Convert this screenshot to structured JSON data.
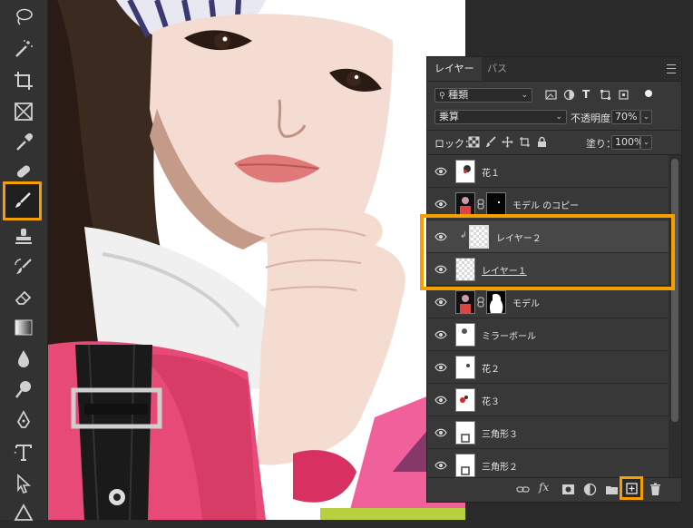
{
  "layers_panel": {
    "tabs": [
      {
        "label": "レイヤー",
        "active": true
      },
      {
        "label": "パス",
        "active": false
      }
    ],
    "filter": {
      "kind_label": "種類"
    },
    "blend_mode": "乗算",
    "opacity": {
      "label": "不透明度：",
      "value": "70%"
    },
    "lock_label": "ロック：",
    "fill": {
      "label": "塗り：",
      "value": "100%"
    },
    "layers": [
      {
        "name": "花１",
        "thumb": "flower",
        "selected": false
      },
      {
        "name": "モデル のコピー",
        "thumb": "model",
        "has_mask": true,
        "selected": false
      },
      {
        "name": "レイヤー２",
        "thumb": "transparent",
        "clipped": true,
        "selected": true
      },
      {
        "name": "レイヤー１",
        "thumb": "transparent",
        "underline": true,
        "selected": false
      },
      {
        "name": "モデル",
        "thumb": "model",
        "has_mask": true,
        "selected": false
      },
      {
        "name": "ミラーボール",
        "thumb": "ball",
        "selected": false
      },
      {
        "name": "花２",
        "thumb": "flower",
        "selected": false
      },
      {
        "name": "花３",
        "thumb": "flower-red",
        "selected": false
      },
      {
        "name": "三角形３",
        "thumb": "triangle",
        "selected": false
      },
      {
        "name": "三角形２",
        "thumb": "triangle",
        "selected": false
      }
    ],
    "footer_icons": [
      "link-icon",
      "fx-icon",
      "mask-icon",
      "adjustment-icon",
      "folder-icon",
      "new-layer-icon",
      "trash-icon"
    ]
  },
  "toolbar": {
    "tools": [
      "lasso-tool",
      "magic-wand-tool",
      "crop-tool",
      "frame-tool",
      "eyedropper-tool",
      "healing-tool",
      "brush-tool",
      "stamp-tool",
      "history-brush-tool",
      "eraser-tool",
      "gradient-tool",
      "blur-tool",
      "dodge-tool",
      "pen-tool",
      "type-tool",
      "path-select-tool",
      "shape-tool"
    ],
    "selected_tool": "brush-tool"
  },
  "accent_color": "#f5a000"
}
